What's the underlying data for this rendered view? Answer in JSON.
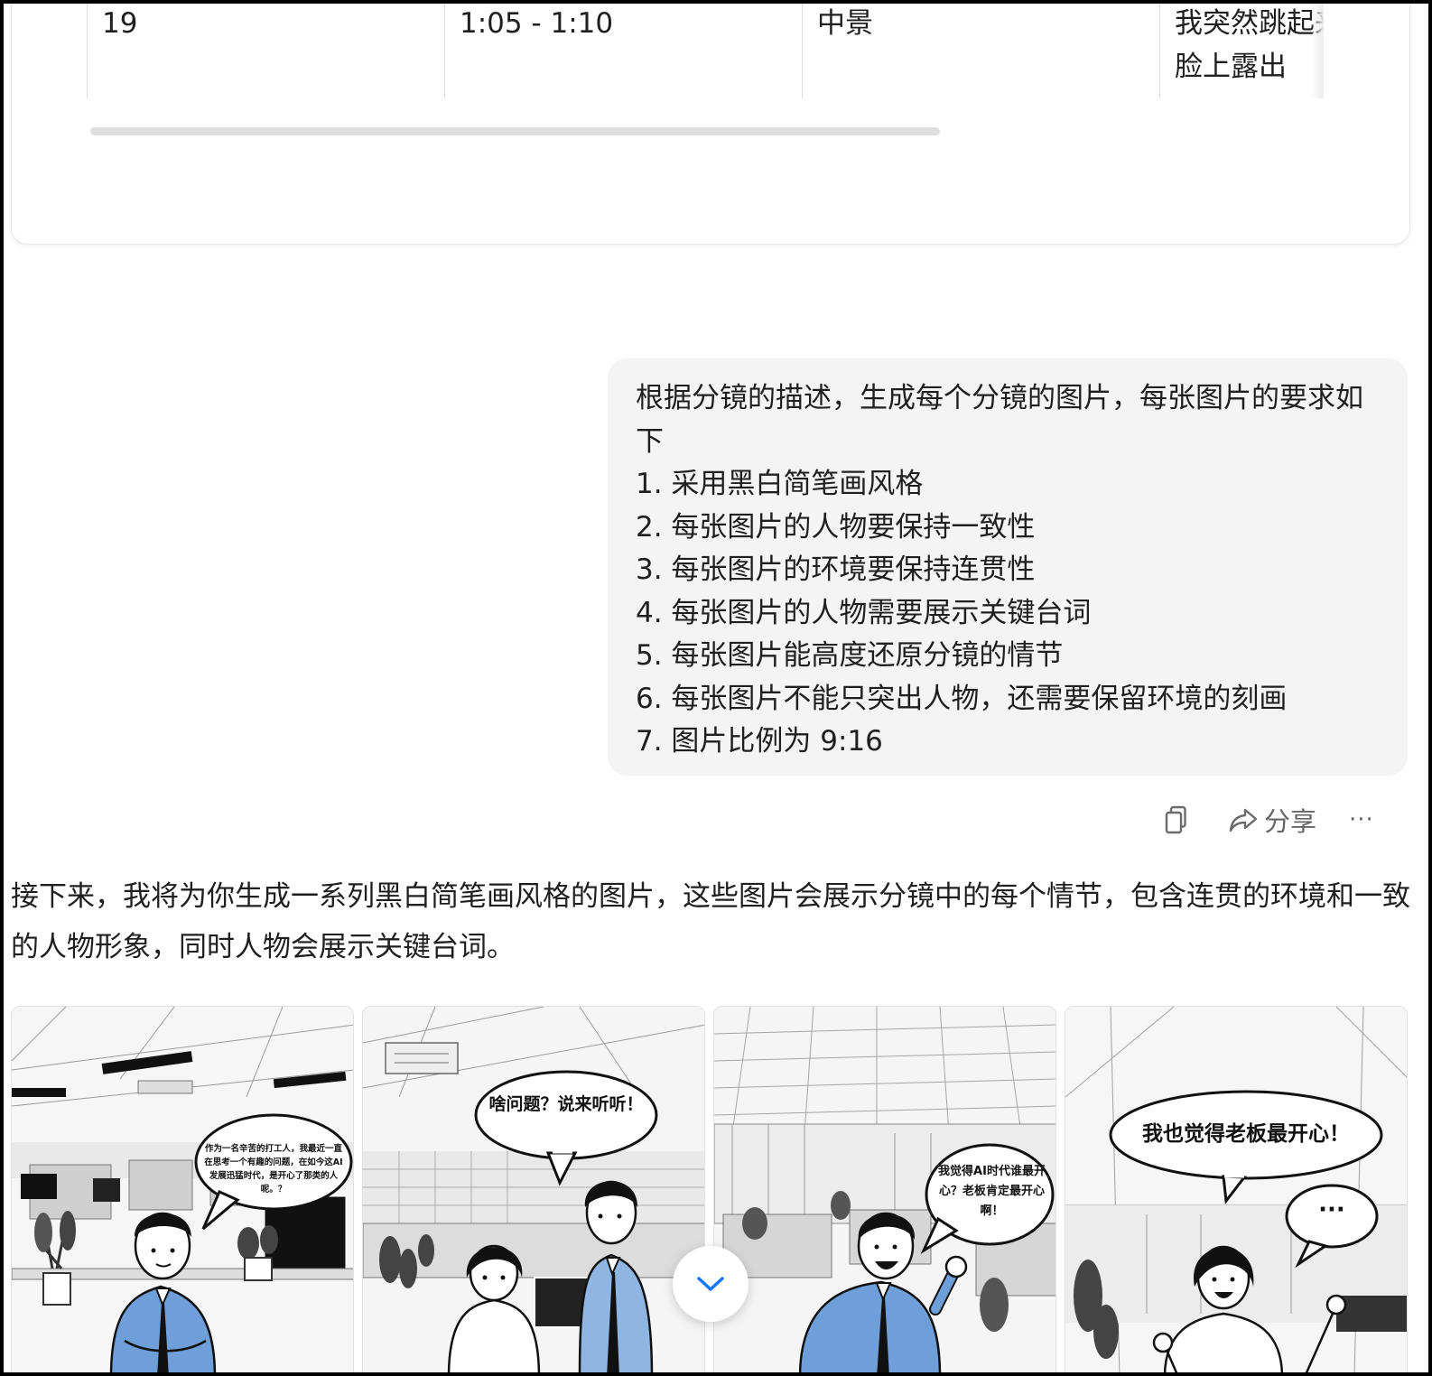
{
  "storyboard_table": {
    "row": {
      "index": "19",
      "time": "1:05 - 1:10",
      "shot": "中景",
      "description": "我突然跳起来，双手高举，脸上露出"
    }
  },
  "user_message": {
    "intro": "根据分镜的描述，生成每个分镜的图片，每张图片的要求如下",
    "requirements": [
      "1. 采用黑白简笔画风格",
      "2. 每张图片的人物要保持一致性",
      "3. 每张图片的环境要保持连贯性",
      "4. 每张图片的人物需要展示关键台词",
      "5. 每张图片能高度还原分镜的情节",
      "6. 每张图片不能只突出人物，还需要保留环境的刻画",
      "7. 图片比例为 9:16"
    ]
  },
  "actions": {
    "copy_icon": "copy-icon",
    "share_label": "分享",
    "more_label": "···"
  },
  "assistant": {
    "reply": "接下来，我将为你生成一系列黑白简笔画风格的图片，这些图片会展示分镜中的每个情节，包含连贯的环境和一致的人物形象，同时人物会展示关键台词。"
  },
  "images": [
    {
      "speech": "作为一名辛苦的打工人，我最近一直在思考一个有趣的问题，在如今这AI发展迅猛时代，是开心了那类的人呢。？"
    },
    {
      "speech": "啥问题？说来听听！"
    },
    {
      "speech": "我觉得AI时代谁最开心？老板肯定最开心啊！"
    },
    {
      "speech": "我也觉得老板最开心！",
      "secondary": "···"
    }
  ],
  "colors": {
    "accent_blue": "#1677ff",
    "shirt_blue": "#6f9fd8",
    "bubble_bg": "#f4f4f4"
  }
}
